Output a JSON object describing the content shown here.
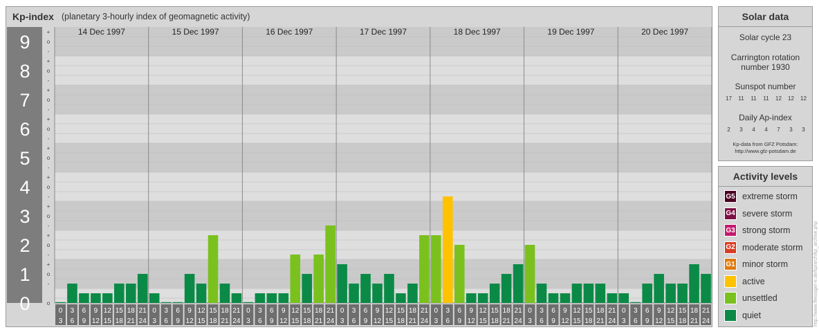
{
  "header": {
    "title": "Kp-index",
    "subtitle": "(planetary 3-hourly index of geomagnetic activity)"
  },
  "chart_data": {
    "type": "bar",
    "ylim": [
      0,
      9
    ],
    "y_ticks": [
      "0",
      "1",
      "2",
      "3",
      "4",
      "5",
      "6",
      "7",
      "8",
      "9"
    ],
    "minor_tick_labels": [
      "o",
      "+",
      "-",
      "o"
    ],
    "days": [
      "14 Dec 1997",
      "15 Dec 1997",
      "16 Dec 1997",
      "17 Dec 1997",
      "18 Dec 1997",
      "19 Dec 1997",
      "20 Dec 1997"
    ],
    "interval_starts": [
      "0",
      "3",
      "6",
      "9",
      "12",
      "15",
      "18",
      "21"
    ],
    "interval_ends": [
      "3",
      "6",
      "9",
      "12",
      "15",
      "18",
      "21",
      "24"
    ],
    "values": [
      [
        0.0,
        0.667,
        0.333,
        0.333,
        0.333,
        0.667,
        0.667,
        1.0
      ],
      [
        0.333,
        0.0,
        0.0,
        1.0,
        0.667,
        2.333,
        0.667,
        0.333
      ],
      [
        0.0,
        0.333,
        0.333,
        0.333,
        1.667,
        1.0,
        1.667,
        2.667
      ],
      [
        1.333,
        0.667,
        1.0,
        0.667,
        1.0,
        0.333,
        0.667,
        2.333
      ],
      [
        2.333,
        3.667,
        2.0,
        0.333,
        0.333,
        0.667,
        1.0,
        1.333
      ],
      [
        2.0,
        0.667,
        0.333,
        0.333,
        0.667,
        0.667,
        0.667,
        0.333
      ],
      [
        0.333,
        0.0,
        0.667,
        1.0,
        0.667,
        0.667,
        1.333,
        1.0
      ]
    ],
    "bar_colors": {
      "quiet": "#0a8a46",
      "unsettled": "#7ac11e",
      "active": "#ffc200"
    }
  },
  "solar": {
    "title": "Solar data",
    "cycle": "Solar cycle 23",
    "carrington_line1": "Carrington rotation",
    "carrington_line2": "number 1930",
    "sunspot_label": "Sunspot number",
    "sunspot_values": [
      "17",
      "11",
      "11",
      "11",
      "12",
      "12",
      "12"
    ],
    "ap_label": "Daily Ap-index",
    "ap_values": [
      "2",
      "3",
      "4",
      "4",
      "7",
      "3",
      "3"
    ],
    "credit_line1": "Kp-data from GFZ Potsdam:",
    "credit_line2": "http://www.gfz-potsdam.de"
  },
  "activity": {
    "title": "Activity levels",
    "levels": [
      {
        "code": "G5",
        "label": "extreme storm",
        "color": "#4a0022"
      },
      {
        "code": "G4",
        "label": "severe storm",
        "color": "#7d0f44"
      },
      {
        "code": "G3",
        "label": "strong storm",
        "color": "#c41a6e"
      },
      {
        "code": "G2",
        "label": "moderate storm",
        "color": "#d93c22"
      },
      {
        "code": "G1",
        "label": "minor storm",
        "color": "#e07b10"
      },
      {
        "code": "",
        "label": "active",
        "color": "#ffc200"
      },
      {
        "code": "",
        "label": "unsettled",
        "color": "#7ac11e"
      },
      {
        "code": "",
        "label": "quiet",
        "color": "#0a8a46"
      }
    ]
  },
  "watermark": "http://www.fleissiger-e.de/kp/arch/kp_archive.php"
}
